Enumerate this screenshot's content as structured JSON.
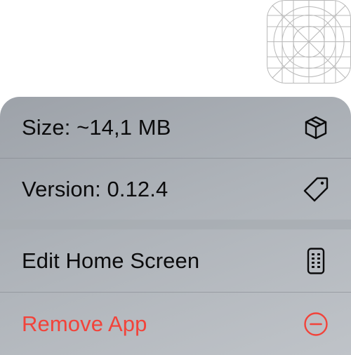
{
  "app_icon": {
    "icon": "app-icon-grid-template"
  },
  "context_menu": {
    "items": [
      {
        "label": "Size: ~14,1 MB",
        "icon": "cube-icon"
      },
      {
        "label": "Version: 0.12.4",
        "icon": "tag-icon"
      },
      {
        "label": "Edit Home Screen",
        "icon": "phone-apps-icon"
      },
      {
        "label": "Remove App",
        "icon": "minus-circle-icon",
        "color": "#f2433a"
      }
    ]
  },
  "colors": {
    "menu_background": "#aeb3b9",
    "text": "#0b0b0c",
    "destructive": "#f2433a"
  }
}
